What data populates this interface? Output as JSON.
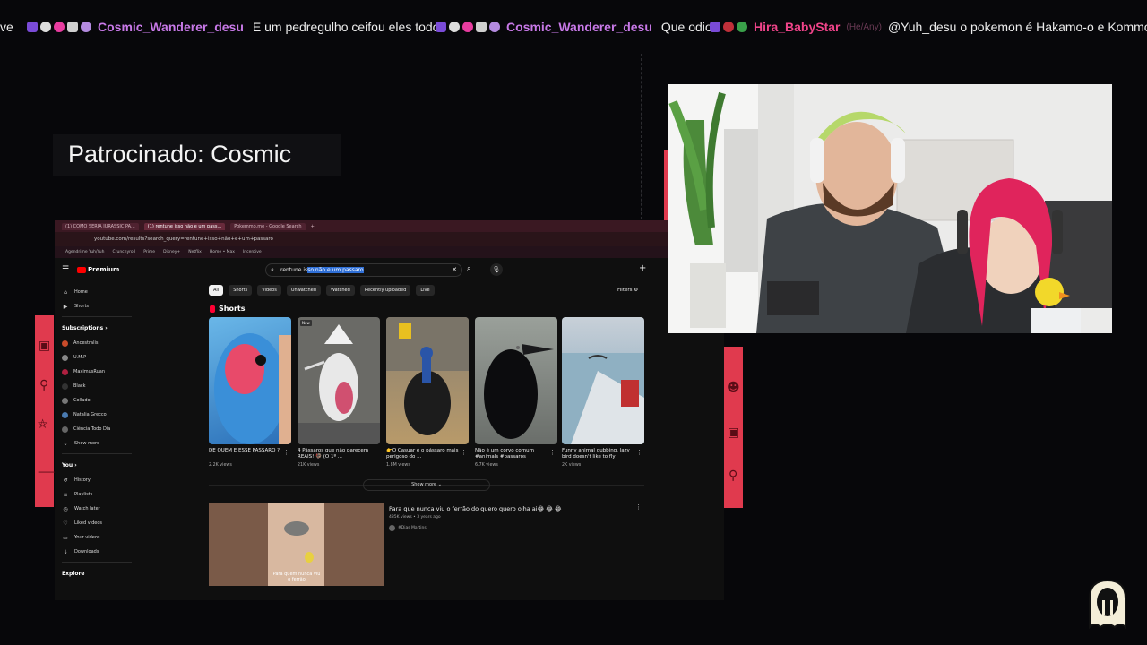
{
  "ticker": {
    "fragment_prefix": "ve",
    "messages": [
      {
        "user": "Cosmic_Wanderer_desu",
        "text": "E um pedregulho ceifou eles todos"
      },
      {
        "user": "Cosmic_Wanderer_desu",
        "text": "Que odio"
      },
      {
        "user": "Hira_BabyStar",
        "pronouns": "(He/Any)",
        "text": "@Yuh_desu o pokemon é Hakamo-o e Kommo-o"
      }
    ]
  },
  "sponsor": {
    "title": "Patrocinado: Cosmic"
  },
  "browser": {
    "tabs": [
      "(1) COMO SERIA JURASSIC PA...",
      "(1) rentune isso não e um pass...",
      "Pokemmo.me - Google Search"
    ],
    "address": "youtube.com/results?search_query=rentune+isso+não+e+um+passaro",
    "bookmarks": [
      "Agendrime Yuh/Yuh",
      "Crunchyroll",
      "Prime",
      "Disney+",
      "Netflix",
      "Home • Max",
      "Incentive"
    ],
    "youtube": {
      "logo_label": "Premium",
      "search_plain": "rentune is",
      "search_selected": "so não e um passaro",
      "chips": [
        "All",
        "Shorts",
        "Videos",
        "Unwatched",
        "Watched",
        "Recently uploaded",
        "Live"
      ],
      "filters_label": "Filters",
      "nav_main": [
        {
          "label": "Home",
          "icon": "home-icon",
          "glyph": "⌂"
        },
        {
          "label": "Shorts",
          "icon": "shorts-icon",
          "glyph": "▶"
        }
      ],
      "subscriptions_label": "Subscriptions",
      "subscriptions": [
        {
          "label": "Ancestralis",
          "color": "#c94b2a"
        },
        {
          "label": "U.M.P",
          "color": "#888888"
        },
        {
          "label": "MaximusRuan",
          "color": "#b02040"
        },
        {
          "label": "Black",
          "color": "#333333"
        },
        {
          "label": "Collado",
          "color": "#777777"
        },
        {
          "label": "Natalia Grecco",
          "color": "#4a7ab0"
        },
        {
          "label": "Ciência Todo Dia",
          "color": "#666666"
        }
      ],
      "show_more_subs": "Show more",
      "you_label": "You",
      "you_items": [
        {
          "label": "History",
          "glyph": "↺"
        },
        {
          "label": "Playlists",
          "glyph": "≡"
        },
        {
          "label": "Watch later",
          "glyph": "◷"
        },
        {
          "label": "Liked videos",
          "glyph": "♡"
        },
        {
          "label": "Your videos",
          "glyph": "▭"
        },
        {
          "label": "Downloads",
          "glyph": "↓"
        }
      ],
      "explore_label": "Explore",
      "shorts_label": "Shorts",
      "shorts": [
        {
          "title": "DE QUEM É ESSE PÁSSARO ?",
          "views": "2.2K views"
        },
        {
          "title": "4 Pássaros que não parecem REAIS! 🦃 (O 1º ...",
          "views": "21K views",
          "tag": "New"
        },
        {
          "title": "👉O Casuar é o pássaro mais perigoso do ...",
          "views": "1.8M views"
        },
        {
          "title": "Não é um corvo comum #animals #passaros",
          "views": "6.7K views"
        },
        {
          "title": "Funny animal dubbing, lazy bird doesn't like to fly",
          "views": "2K views"
        }
      ],
      "shorts_show_more": "Show more",
      "video": {
        "title": "Para que nunca viu o ferrão do quero quero olha ai😂 😂 😂",
        "meta": "485K views • 3 years ago",
        "channel": "#Dias Martins",
        "thumb_caption": "Para quem nunca viu o ferrão"
      }
    }
  },
  "colors": {
    "accent": "#e03a4e",
    "chat_user": "#c879e8",
    "chat_user_alt": "#f0448a",
    "yt_red": "#ff0000"
  }
}
